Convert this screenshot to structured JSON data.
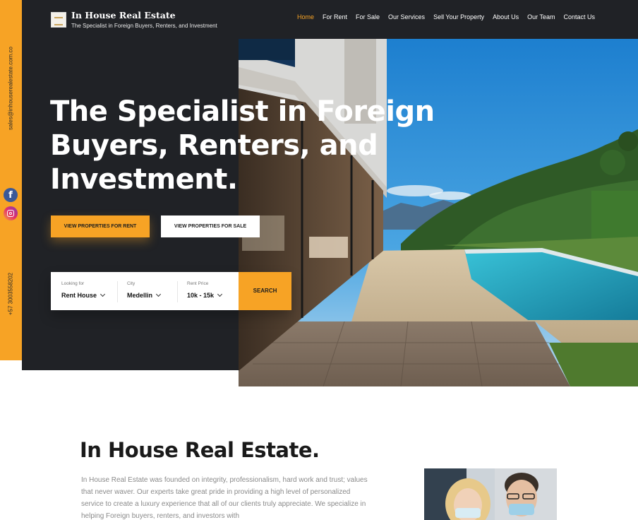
{
  "sidebar": {
    "email": "sales@inhouserealestate.com.co",
    "phone": "+57 3003558202",
    "social": [
      {
        "icon": "facebook-icon",
        "label": "f",
        "color": "#3b5998"
      },
      {
        "icon": "instagram-icon",
        "label": ""
      }
    ]
  },
  "header": {
    "brand_name": "In House Real Estate",
    "brand_tagline": "The Specialist in Foreign Buyers, Renters, and Investment",
    "nav": [
      {
        "label": "Home",
        "active": true
      },
      {
        "label": "For Rent"
      },
      {
        "label": "For Sale"
      },
      {
        "label": "Our Services"
      },
      {
        "label": "Sell Your Property"
      },
      {
        "label": "About Us"
      },
      {
        "label": "Our Team"
      },
      {
        "label": "Contact Us"
      }
    ]
  },
  "hero": {
    "headline": "The Specialist in Foreign Buyers, Renters, and Investment.",
    "cta_rent": "VIEW PROPERTIES FOR RENT",
    "cta_sale": "VIEW PROPERTIES FOR SALE"
  },
  "search": {
    "fields": [
      {
        "label": "Looking for",
        "value": "Rent House"
      },
      {
        "label": "City",
        "value": "Medellin"
      },
      {
        "label": "Rent Price",
        "value": "10k - 15k"
      }
    ],
    "button": "SEARCH"
  },
  "about": {
    "title": "In House Real Estate.",
    "body": "In House Real Estate was founded on integrity, professionalism, hard work and trust; values that never waver.  Our experts take great pride in providing a high level of personalized service to create a luxury experience that all of our clients truly appreciate. We specialize in helping Foreign buyers, renters, and investors with"
  },
  "colors": {
    "accent": "#f7a325",
    "dark_panel": "#202226",
    "text_muted": "#8a8a8a"
  }
}
